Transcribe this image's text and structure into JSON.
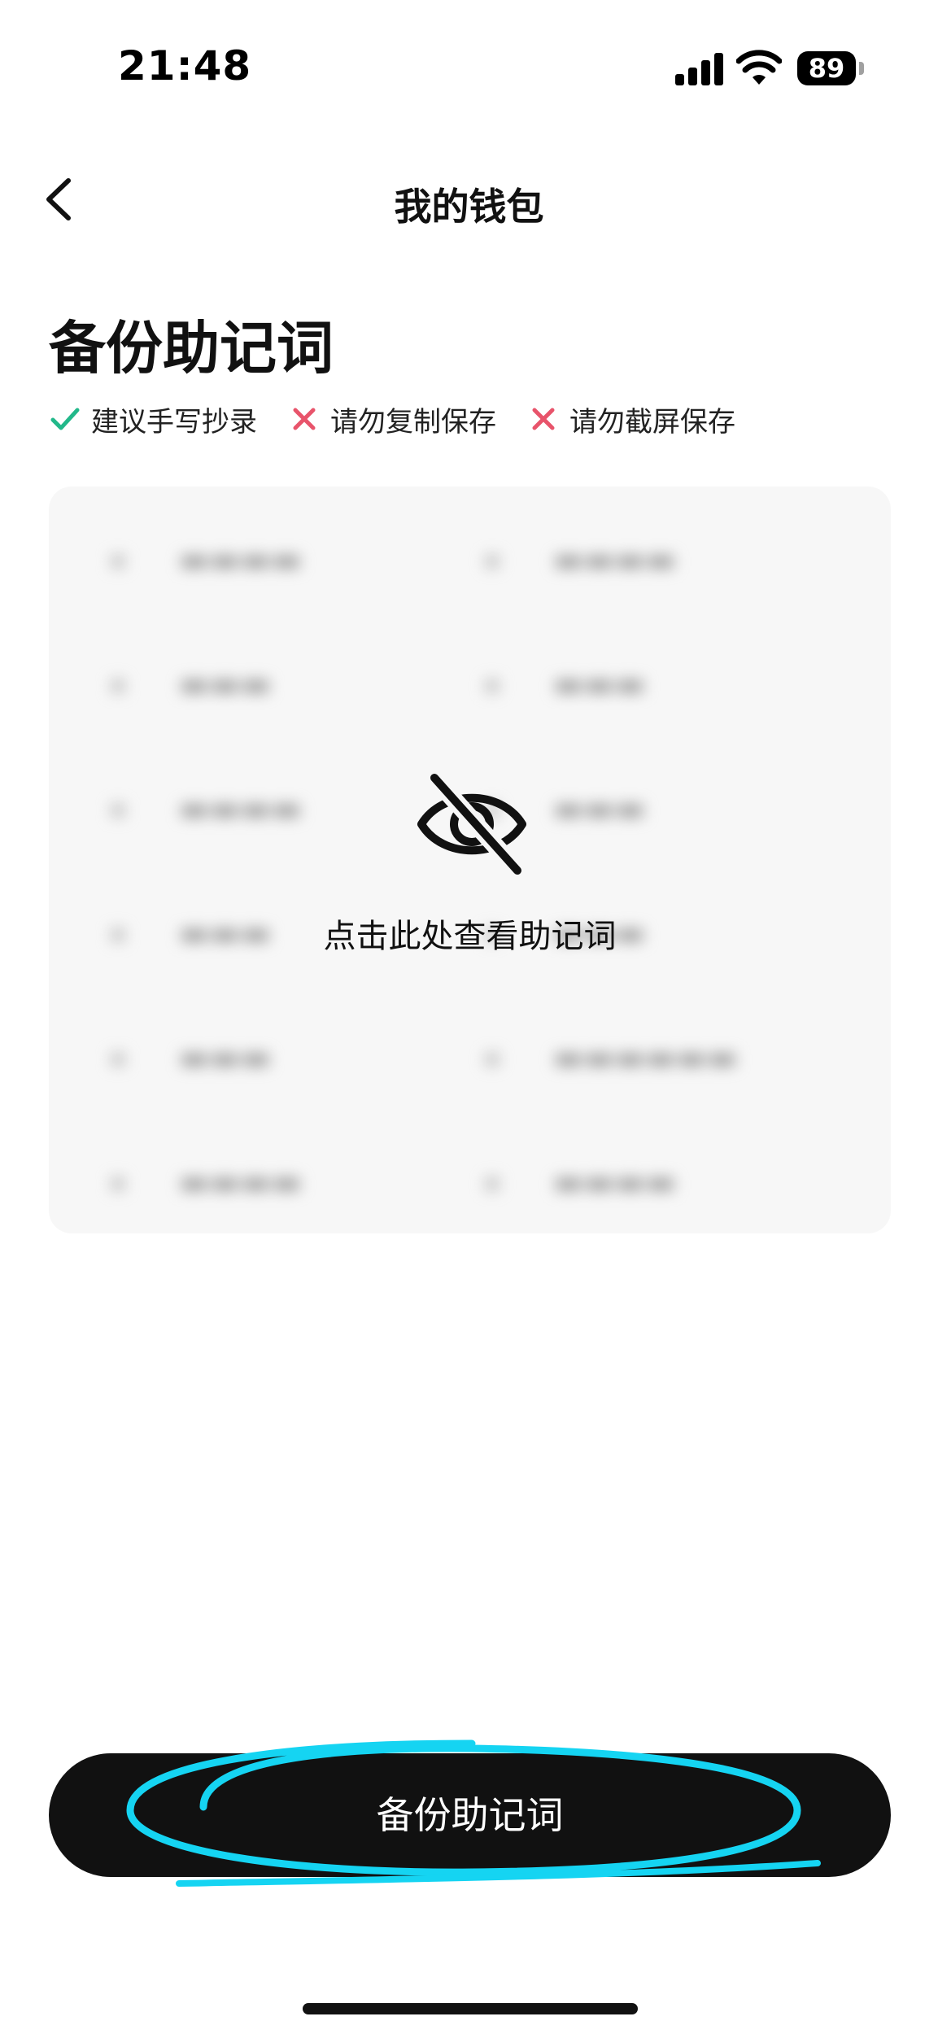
{
  "status_bar": {
    "time": "21:48",
    "battery": "89"
  },
  "nav": {
    "title": "我的钱包",
    "back_icon": "chevron-left-icon"
  },
  "page": {
    "heading": "备份助记词"
  },
  "tips": [
    {
      "icon": "check-icon",
      "text": "建议手写抄录",
      "color": "#22b88a"
    },
    {
      "icon": "cross-icon",
      "text": "请勿复制保存",
      "color": "#e8546b"
    },
    {
      "icon": "cross-icon",
      "text": "请勿截屏保存",
      "color": "#e8546b"
    }
  ],
  "mnemonic": {
    "hidden_icon": "eye-off-icon",
    "reveal_prompt": "点击此处查看助记词"
  },
  "actions": {
    "backup_label": "备份助记词",
    "highlight_color": "#15d4f2"
  }
}
